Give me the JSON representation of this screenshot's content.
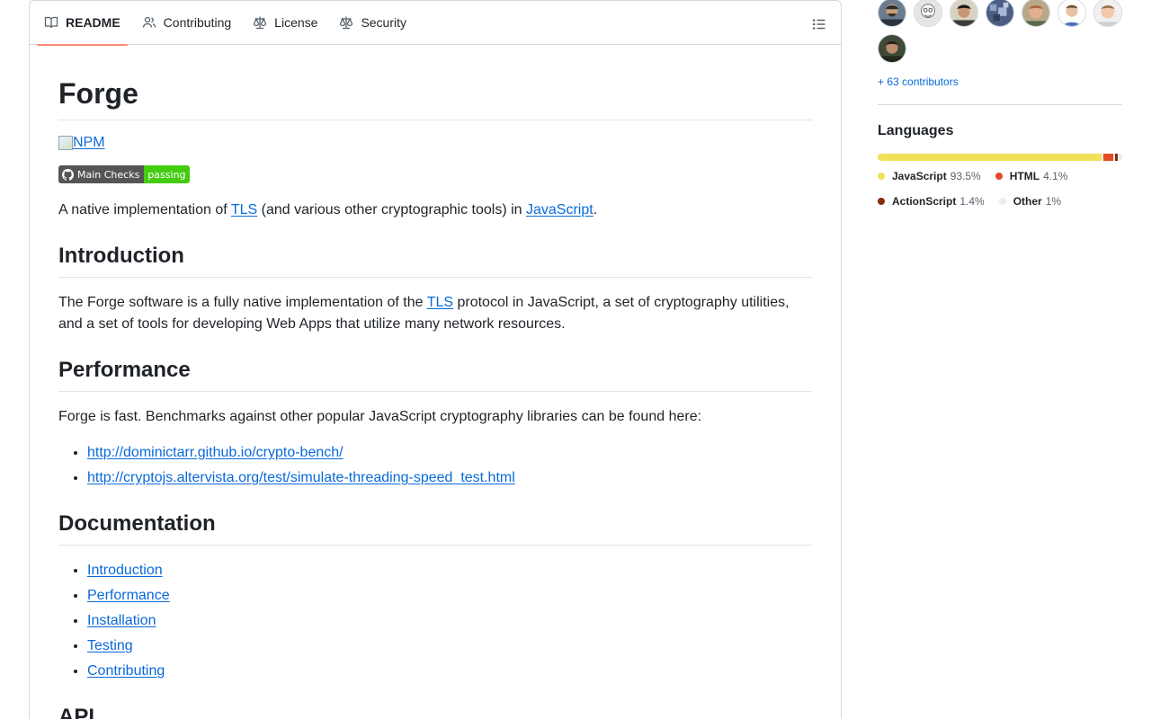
{
  "tabs": [
    {
      "label": "README",
      "icon": "book-icon",
      "active": true
    },
    {
      "label": "Contributing",
      "icon": "people-icon"
    },
    {
      "label": "License",
      "icon": "law-icon"
    },
    {
      "label": "Security",
      "icon": "law-icon"
    }
  ],
  "readme": {
    "title": "Forge",
    "npm_alt": "NPM",
    "badge": {
      "left": "Main Checks",
      "right": "passing"
    },
    "intro_parts": [
      "A native implementation of ",
      "TLS",
      " (and various other cryptographic tools) in ",
      "JavaScript",
      "."
    ],
    "sections": {
      "introduction": {
        "heading": "Introduction",
        "text_parts": [
          "The Forge software is a fully native implementation of the ",
          "TLS",
          " protocol in JavaScript, a set of cryptography utilities, and a set of tools for developing Web Apps that utilize many network resources."
        ]
      },
      "performance": {
        "heading": "Performance",
        "text": "Forge is fast. Benchmarks against other popular JavaScript cryptography libraries can be found here:",
        "links": [
          "http://dominictarr.github.io/crypto-bench/",
          "http://cryptojs.altervista.org/test/simulate-threading-speed_test.html"
        ]
      },
      "documentation": {
        "heading": "Documentation",
        "links": [
          "Introduction",
          "Performance",
          "Installation",
          "Testing",
          "Contributing"
        ]
      },
      "api": {
        "heading": "API"
      }
    }
  },
  "sidebar": {
    "contributors_link": "+ 63 contributors",
    "languages_title": "Languages",
    "languages": [
      {
        "name": "JavaScript",
        "pct": "93.5%",
        "value": 93.5,
        "color": "#f1e05a"
      },
      {
        "name": "HTML",
        "pct": "4.1%",
        "value": 4.1,
        "color": "#e34c26"
      },
      {
        "name": "ActionScript",
        "pct": "1.4%",
        "value": 1.4,
        "color": "#882b0f"
      },
      {
        "name": "Other",
        "pct": "1%",
        "value": 1.0,
        "color": "#ededed"
      }
    ]
  }
}
